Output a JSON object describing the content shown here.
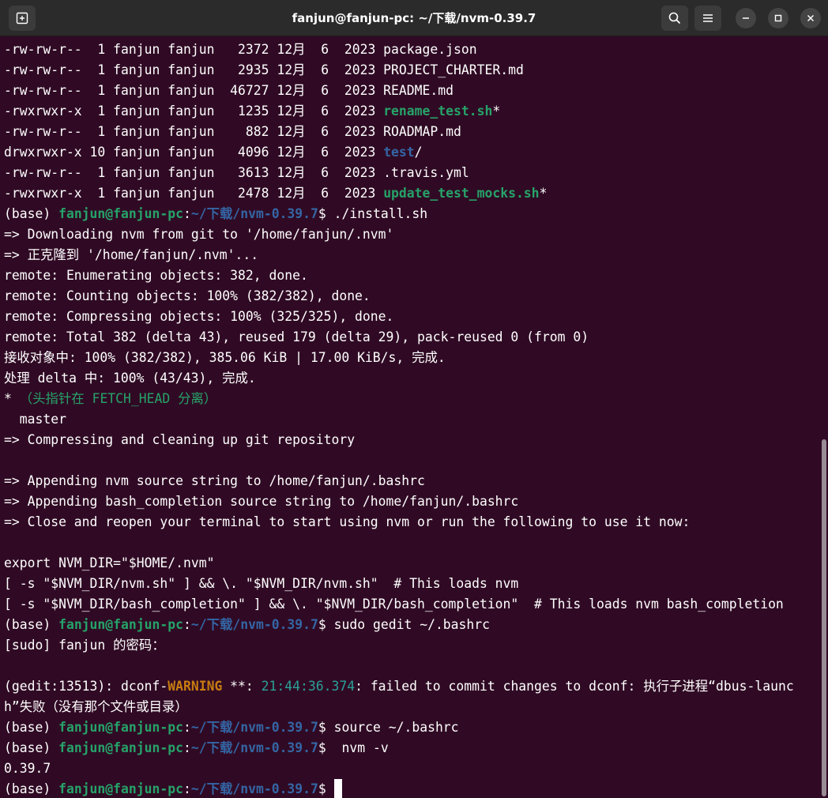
{
  "window": {
    "title": "fanjun@fanjun-pc: ~/下载/nvm-0.39.7",
    "buttons": {
      "new_tab": "new-tab-icon",
      "search": "search-icon",
      "menu": "hamburger-menu-icon",
      "minimize": "minimize-icon",
      "maximize": "maximize-icon",
      "close": "close-icon"
    }
  },
  "colors": {
    "background": "#300a24",
    "text": "#ffffff",
    "green": "#26a269",
    "blue": "#3465a4",
    "orange": "#c77c11",
    "teal": "#2aa198"
  },
  "terminal": {
    "lines": [
      [
        {
          "t": "-rw-rw-r--  1 fanjun fanjun   2372 12月  6  2023 package.json"
        }
      ],
      [
        {
          "t": "-rw-rw-r--  1 fanjun fanjun   2935 12月  6  2023 PROJECT_CHARTER.md"
        }
      ],
      [
        {
          "t": "-rw-rw-r--  1 fanjun fanjun  46727 12月  6  2023 README.md"
        }
      ],
      [
        {
          "t": "-rwxrwxr-x  1 fanjun fanjun   1235 12月  6  2023 "
        },
        {
          "t": "rename_test.sh",
          "c": "green",
          "b": true
        },
        {
          "t": "*"
        }
      ],
      [
        {
          "t": "-rw-rw-r--  1 fanjun fanjun    882 12月  6  2023 ROADMAP.md"
        }
      ],
      [
        {
          "t": "drwxrwxr-x 10 fanjun fanjun   4096 12月  6  2023 "
        },
        {
          "t": "test",
          "c": "blue",
          "b": true
        },
        {
          "t": "/"
        }
      ],
      [
        {
          "t": "-rw-rw-r--  1 fanjun fanjun   3613 12月  6  2023 .travis.yml"
        }
      ],
      [
        {
          "t": "-rwxrwxr-x  1 fanjun fanjun   2478 12月  6  2023 "
        },
        {
          "t": "update_test_mocks.sh",
          "c": "green",
          "b": true
        },
        {
          "t": "*"
        }
      ],
      [
        {
          "t": "(base) "
        },
        {
          "t": "fanjun@fanjun-pc",
          "c": "green",
          "b": true
        },
        {
          "t": ":"
        },
        {
          "t": "~/下载/nvm-0.39.7",
          "c": "blue",
          "b": true
        },
        {
          "t": "$ ./install.sh"
        }
      ],
      [
        {
          "t": "=> Downloading nvm from git to '/home/fanjun/.nvm'"
        }
      ],
      [
        {
          "t": "=> 正克隆到 '/home/fanjun/.nvm'..."
        }
      ],
      [
        {
          "t": "remote: Enumerating objects: 382, done."
        }
      ],
      [
        {
          "t": "remote: Counting objects: 100% (382/382), done."
        }
      ],
      [
        {
          "t": "remote: Compressing objects: 100% (325/325), done."
        }
      ],
      [
        {
          "t": "remote: Total 382 (delta 43), reused 179 (delta 29), pack-reused 0 (from 0)"
        }
      ],
      [
        {
          "t": "接收对象中: 100% (382/382), 385.06 KiB | 17.00 KiB/s, 完成."
        }
      ],
      [
        {
          "t": "处理 delta 中: 100% (43/43), 完成."
        }
      ],
      [
        {
          "t": "* "
        },
        {
          "t": "（头指针在 FETCH_HEAD 分离）",
          "c": "green"
        }
      ],
      [
        {
          "t": "  master"
        }
      ],
      [
        {
          "t": "=> Compressing and cleaning up git repository"
        }
      ],
      [
        {
          "t": ""
        }
      ],
      [
        {
          "t": "=> Appending nvm source string to /home/fanjun/.bashrc"
        }
      ],
      [
        {
          "t": "=> Appending bash_completion source string to /home/fanjun/.bashrc"
        }
      ],
      [
        {
          "t": "=> Close and reopen your terminal to start using nvm or run the following to use it now:"
        }
      ],
      [
        {
          "t": ""
        }
      ],
      [
        {
          "t": "export NVM_DIR=\"$HOME/.nvm\""
        }
      ],
      [
        {
          "t": "[ -s \"$NVM_DIR/nvm.sh\" ] && \\. \"$NVM_DIR/nvm.sh\"  # This loads nvm"
        }
      ],
      [
        {
          "t": "[ -s \"$NVM_DIR/bash_completion\" ] && \\. \"$NVM_DIR/bash_completion\"  # This loads nvm bash_completion"
        }
      ],
      [
        {
          "t": "(base) "
        },
        {
          "t": "fanjun@fanjun-pc",
          "c": "green",
          "b": true
        },
        {
          "t": ":"
        },
        {
          "t": "~/下载/nvm-0.39.7",
          "c": "blue",
          "b": true
        },
        {
          "t": "$ sudo gedit ~/.bashrc"
        }
      ],
      [
        {
          "t": "[sudo] fanjun 的密码："
        }
      ],
      [
        {
          "t": ""
        }
      ],
      [
        {
          "t": "(gedit:13513): dconf-"
        },
        {
          "t": "WARNING",
          "c": "orange",
          "b": true
        },
        {
          "t": " **: "
        },
        {
          "t": "21:44:36.374",
          "c": "teal"
        },
        {
          "t": ": failed to commit changes to dconf: 执行子进程“dbus-launc"
        }
      ],
      [
        {
          "t": "h”失败（没有那个文件或目录）"
        }
      ],
      [
        {
          "t": "(base) "
        },
        {
          "t": "fanjun@fanjun-pc",
          "c": "green",
          "b": true
        },
        {
          "t": ":"
        },
        {
          "t": "~/下载/nvm-0.39.7",
          "c": "blue",
          "b": true
        },
        {
          "t": "$ source ~/.bashrc"
        }
      ],
      [
        {
          "t": "(base) "
        },
        {
          "t": "fanjun@fanjun-pc",
          "c": "green",
          "b": true
        },
        {
          "t": ":"
        },
        {
          "t": "~/下载/nvm-0.39.7",
          "c": "blue",
          "b": true
        },
        {
          "t": "$  nvm -v"
        }
      ],
      [
        {
          "t": "0.39.7"
        }
      ],
      [
        {
          "t": "(base) "
        },
        {
          "t": "fanjun@fanjun-pc",
          "c": "green",
          "b": true
        },
        {
          "t": ":"
        },
        {
          "t": "~/下载/nvm-0.39.7",
          "c": "blue",
          "b": true
        },
        {
          "t": "$ "
        },
        {
          "cursor": true
        }
      ]
    ]
  }
}
